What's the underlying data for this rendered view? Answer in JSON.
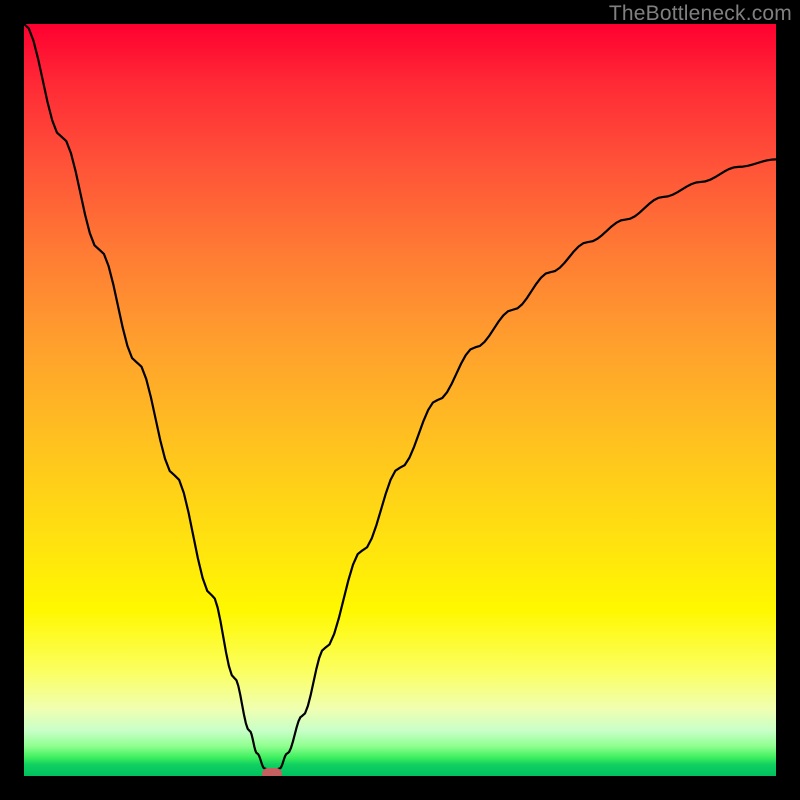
{
  "watermark": "TheBottleneck.com",
  "chart_data": {
    "type": "line",
    "title": "",
    "xlabel": "",
    "ylabel": "",
    "xlim": [
      0,
      100
    ],
    "ylim": [
      0,
      100
    ],
    "grid": false,
    "series": [
      {
        "name": "bottleneck-curve",
        "x": [
          0,
          5,
          10,
          15,
          20,
          25,
          28,
          30,
          31,
          32,
          33,
          34,
          35,
          37,
          40,
          45,
          50,
          55,
          60,
          65,
          70,
          75,
          80,
          85,
          90,
          95,
          100
        ],
        "values": [
          100,
          85,
          70,
          55,
          40,
          24,
          13,
          6,
          3,
          1,
          0.3,
          1,
          3,
          8,
          17,
          30,
          41,
          50,
          57,
          62,
          67,
          71,
          74,
          77,
          79,
          81,
          82
        ]
      }
    ],
    "marker": {
      "x": 33,
      "y": 0.3,
      "color": "#c46060"
    },
    "background_gradient": {
      "top": "#ff0030",
      "mid": "#fff800",
      "bottom": "#00c060"
    }
  }
}
